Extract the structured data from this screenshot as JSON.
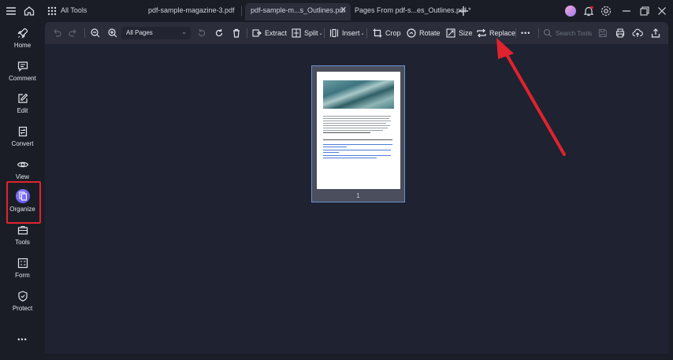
{
  "titlebar": {
    "all_tools_label": "All Tools",
    "tabs": [
      {
        "label": "pdf-sample-magazine-3.pdf"
      },
      {
        "label": "pdf-sample-m...s_Outlines.pdf"
      },
      {
        "label": "Pages From pdf-s...es_Outlines.pdf *"
      }
    ]
  },
  "sidebar": {
    "items": [
      {
        "label": "Home"
      },
      {
        "label": "Comment"
      },
      {
        "label": "Edit"
      },
      {
        "label": "Convert"
      },
      {
        "label": "View"
      },
      {
        "label": "Organize"
      },
      {
        "label": "Tools"
      },
      {
        "label": "Form"
      },
      {
        "label": "Protect"
      }
    ],
    "more": "•••"
  },
  "toolbar": {
    "page_range": "All Pages",
    "extract": "Extract",
    "split": "Split",
    "insert": "Insert",
    "crop": "Crop",
    "rotate": "Rotate",
    "size": "Size",
    "replace": "Replace",
    "more": "•••",
    "search_placeholder": "Search Tools"
  },
  "document": {
    "page_number": "1"
  },
  "colors": {
    "accent_red": "#e1222f",
    "organize_purple": "#6a5cf2",
    "page_border": "#6e8fce"
  }
}
